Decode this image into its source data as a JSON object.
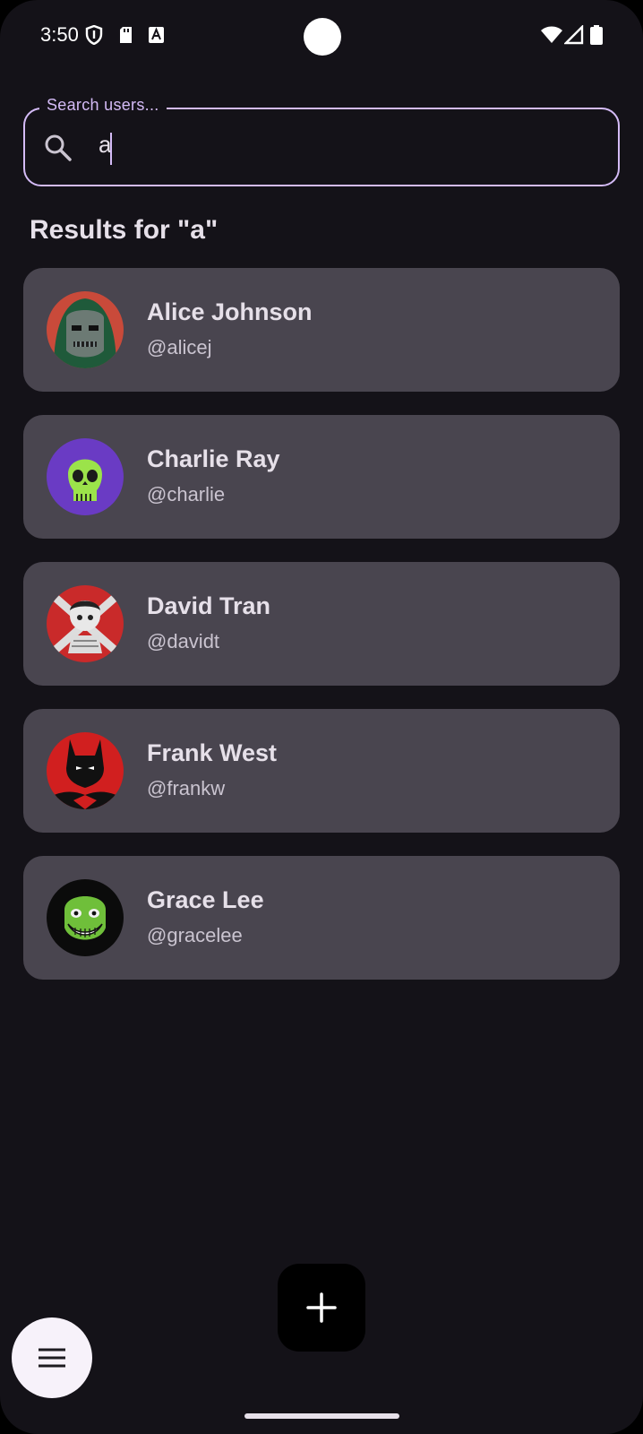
{
  "status_bar": {
    "time": "3:50",
    "icons": [
      "shield-icon",
      "sd-card-icon",
      "font-icon",
      "wifi-icon",
      "signal-icon",
      "battery-icon"
    ]
  },
  "search": {
    "label": "Search users...",
    "value": "a"
  },
  "results": {
    "title": "Results for \"a\""
  },
  "users": [
    {
      "name": "Alice Johnson",
      "handle": "@alicej",
      "avatar": "doom-mask-avatar"
    },
    {
      "name": "Charlie Ray",
      "handle": "@charlie",
      "avatar": "green-skull-avatar"
    },
    {
      "name": "David Tran",
      "handle": "@davidt",
      "avatar": "red-doll-avatar"
    },
    {
      "name": "Frank West",
      "handle": "@frankw",
      "avatar": "batman-avatar"
    },
    {
      "name": "Grace Lee",
      "handle": "@gracelee",
      "avatar": "green-grin-avatar"
    }
  ],
  "fab": {
    "icon": "plus-icon"
  },
  "menu_button": {
    "icon": "menu-icon"
  },
  "colors": {
    "background": "#141218",
    "card": "#49454f",
    "accent": "#d4bbf6",
    "text_primary": "#e6e0e9",
    "text_secondary": "#cac4d0"
  }
}
